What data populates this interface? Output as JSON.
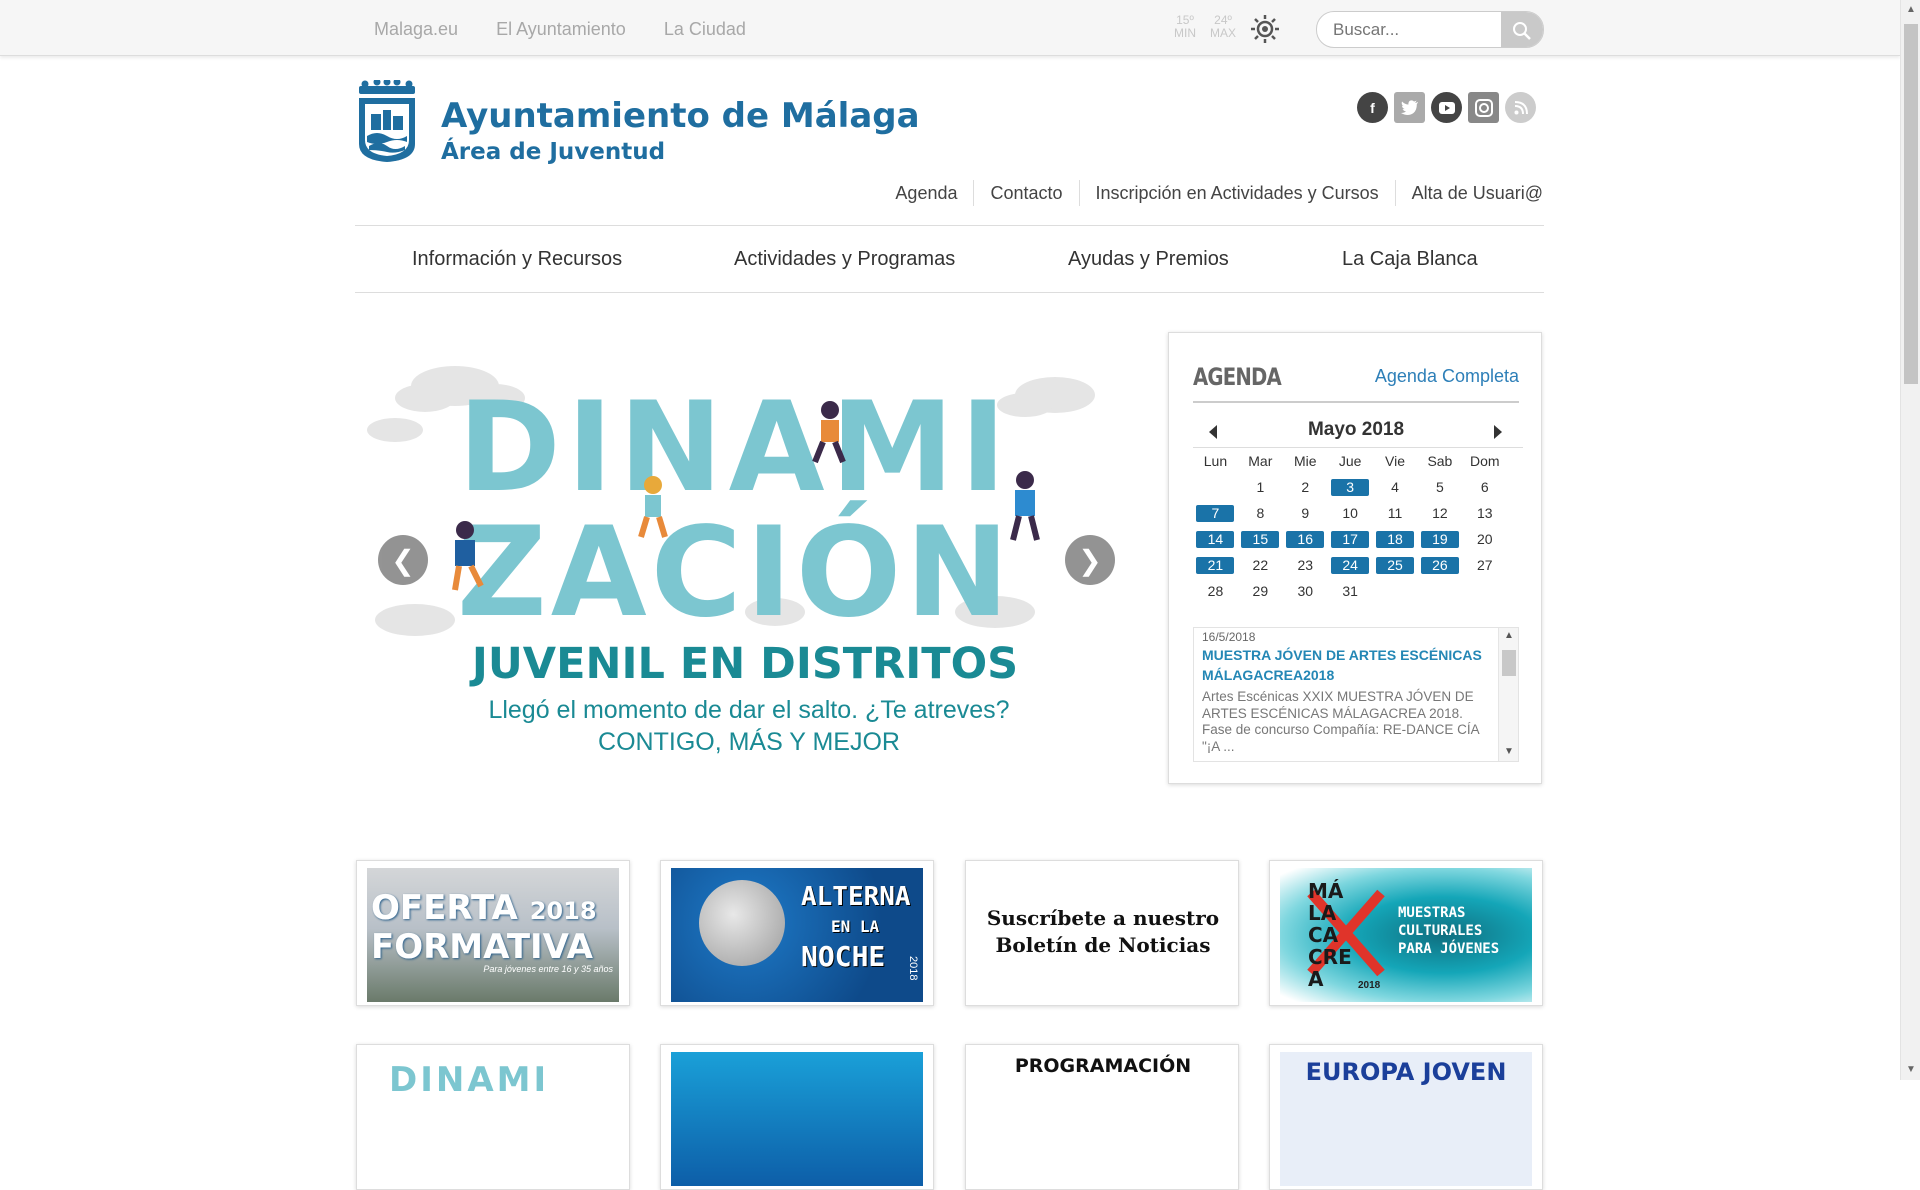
{
  "topbar": {
    "links": [
      "Malaga.eu",
      "El Ayuntamiento",
      "La Ciudad"
    ],
    "weather": {
      "min_temp": "15º",
      "min_label": "MIN",
      "max_temp": "24º",
      "max_label": "MAX"
    },
    "search_placeholder": "Buscar..."
  },
  "header": {
    "title": "Ayuntamiento de Málaga",
    "subtitle": "Área de Juventud",
    "social": [
      "facebook-icon",
      "twitter-icon",
      "youtube-icon",
      "instagram-icon",
      "rss-icon"
    ],
    "util_links": [
      "Agenda",
      "Contacto",
      "Inscripción en Actividades y Cursos",
      "Alta de Usuari@"
    ]
  },
  "nav": {
    "items": [
      "Información y Recursos",
      "Actividades y Programas",
      "Ayudas y Premios",
      "La Caja Blanca"
    ]
  },
  "slider": {
    "line1": "DINAMI",
    "line2": "ZACIÓN",
    "line3": "JUVENIL EN DISTRITOS",
    "line4": "Llegó el momento de dar el salto. ¿Te atreves?",
    "line5": "CONTIGO, MÁS Y MEJOR",
    "prev": "❮",
    "next": "❯"
  },
  "agenda": {
    "title": "AGENDA",
    "link": "Agenda Completa",
    "month": "Mayo 2018",
    "days_of_week": [
      "Lun",
      "Mar",
      "Mie",
      "Jue",
      "Vie",
      "Sab",
      "Dom"
    ],
    "weeks": [
      [
        "",
        "1",
        "2",
        "3",
        "4",
        "5",
        "6"
      ],
      [
        "7",
        "8",
        "9",
        "10",
        "11",
        "12",
        "13"
      ],
      [
        "14",
        "15",
        "16",
        "17",
        "18",
        "19",
        "20"
      ],
      [
        "21",
        "22",
        "23",
        "24",
        "25",
        "26",
        "27"
      ],
      [
        "28",
        "29",
        "30",
        "31",
        "",
        "",
        ""
      ]
    ],
    "event_days": [
      "3",
      "7",
      "14",
      "15",
      "16",
      "17",
      "18",
      "19",
      "21",
      "24",
      "25",
      "26"
    ],
    "event": {
      "date": "16/5/2018",
      "title": "MUESTRA JÓVEN DE ARTES ESCÉNICAS MÁLAGACREA2018",
      "description": "Artes Escénicas XXIX MUESTRA JÓVEN DE ARTES ESCÉNICAS MÁLAGACREA 2018. Fase de concurso Compañía: RE-DANCE CÍA \"¡A ..."
    }
  },
  "tiles": {
    "t1": {
      "line1": "OFERTA",
      "year": "2018",
      "line2": "FORMATIVA",
      "small": "Para jóvenes entre 16 y 35 años"
    },
    "t2": {
      "w1": "ALTERNA",
      "w2": "EN LA",
      "w3": "NOCHE",
      "year": "2018"
    },
    "t3": {
      "line1": "Suscríbete a nuestro",
      "line2": "Boletín de Noticias"
    },
    "t4": {
      "l1": "MÁ",
      "l2": "LA",
      "l3": "CA",
      "l4": "CRE",
      "l5": "A",
      "year": "2018",
      "m1": "MUESTRAS",
      "m2": "CULTURALES",
      "m3": "PARA JÓVENES"
    },
    "b1": {
      "text": "DINAMI"
    },
    "b3": {
      "text": "PROGRAMACIÓN"
    },
    "b4": {
      "text": "EUROPA JOVEN"
    }
  },
  "colors": {
    "brand_blue": "#1f6ea0",
    "calendar_blue": "#1a73a8",
    "slider_teal": "#7cc6d0"
  }
}
